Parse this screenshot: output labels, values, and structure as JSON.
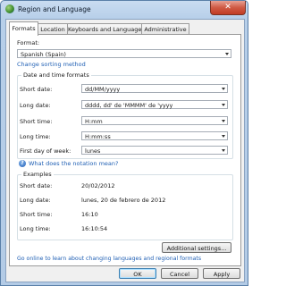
{
  "window": {
    "title": "Region and Language",
    "close_symbol": "✕",
    "icon": "region-globe-icon"
  },
  "tabs": [
    {
      "label": "Formats",
      "active": true
    },
    {
      "label": "Location",
      "active": false
    },
    {
      "label": "Keyboards and Languages",
      "active": false
    },
    {
      "label": "Administrative",
      "active": false
    }
  ],
  "format": {
    "label": "Format:",
    "value": "Spanish (Spain)",
    "sorting_link": "Change sorting method"
  },
  "date_time": {
    "group_title": "Date and time formats",
    "rows": [
      {
        "label": "Short date:",
        "value": "dd/MM/yyyy"
      },
      {
        "label": "Long date:",
        "value": "dddd, dd' de 'MMMM' de 'yyyy"
      },
      {
        "label": "Short time:",
        "value": "H:mm"
      },
      {
        "label": "Long time:",
        "value": "H:mm:ss"
      },
      {
        "label": "First day of week:",
        "value": "lunes"
      }
    ],
    "notation_link": "What does the notation mean?",
    "help_icon": "help-icon"
  },
  "examples": {
    "group_title": "Examples",
    "rows": [
      {
        "label": "Short date:",
        "value": "20/02/2012"
      },
      {
        "label": "Long date:",
        "value": "lunes, 20 de febrero de 2012"
      },
      {
        "label": "Short time:",
        "value": "16:10"
      },
      {
        "label": "Long time:",
        "value": "16:10:54"
      }
    ]
  },
  "additional_settings_label": "Additional settings...",
  "online_link": "Go online to learn about changing languages and regional formats",
  "buttons": {
    "ok": "OK",
    "cancel": "Cancel",
    "apply": "Apply"
  }
}
